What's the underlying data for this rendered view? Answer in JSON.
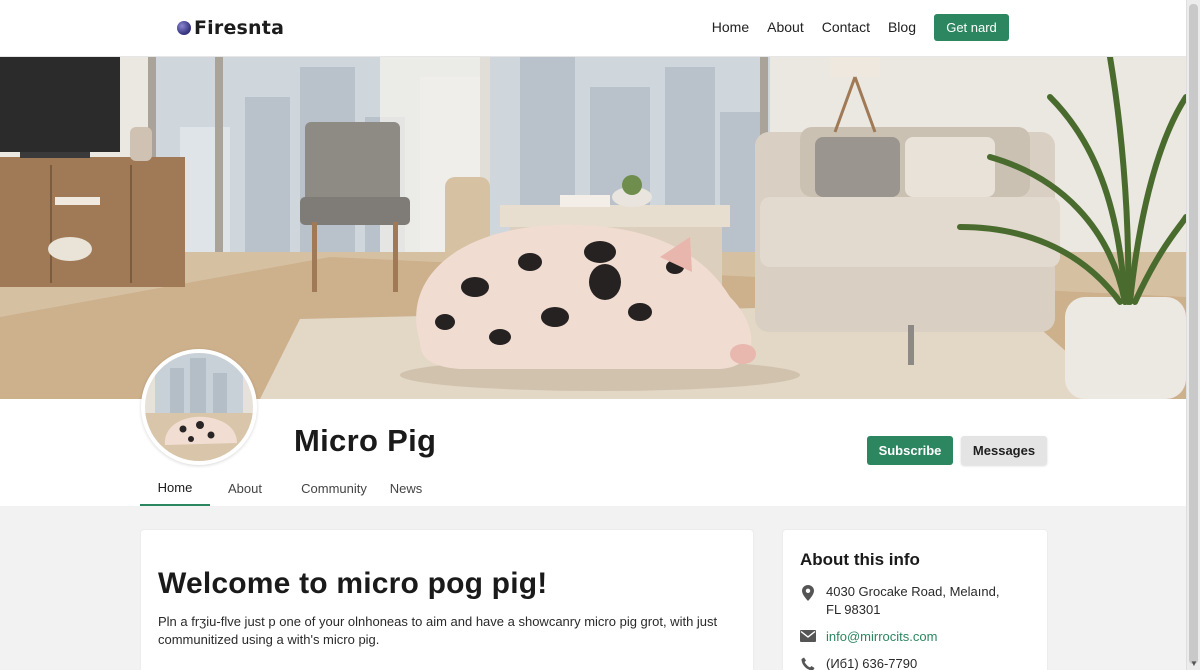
{
  "header": {
    "logo_text": "Firesnta",
    "nav": [
      "Home",
      "About",
      "Contact",
      "Blog"
    ],
    "cta_label": "Get nard"
  },
  "profile": {
    "title": "Micro Pig",
    "subscribe_label": "Subscribe",
    "messages_label": "Messages",
    "tabs": [
      "Home",
      "About",
      "Community",
      "News"
    ],
    "active_tab": "Home"
  },
  "main": {
    "heading": "Welcome to micro pog pig!",
    "body": "Pln a frʒiu-flve just p one of your olnhoneas to aim and have a showcanry micro pig grot, with just communitized using a with's micro pig."
  },
  "about_info": {
    "heading": "About this info",
    "address": "4030 Grocake Road, Melaınd, FL 98301",
    "email": "info@mirrocits.com",
    "phone": "(Иб1) 636-7790"
  },
  "icons": {
    "logo": "globe-icon",
    "address": "map-pin-icon",
    "email": "envelope-icon",
    "phone": "phone-icon"
  },
  "colors": {
    "accent": "#2c8660",
    "background": "#f2f2f2",
    "card": "#ffffff"
  }
}
